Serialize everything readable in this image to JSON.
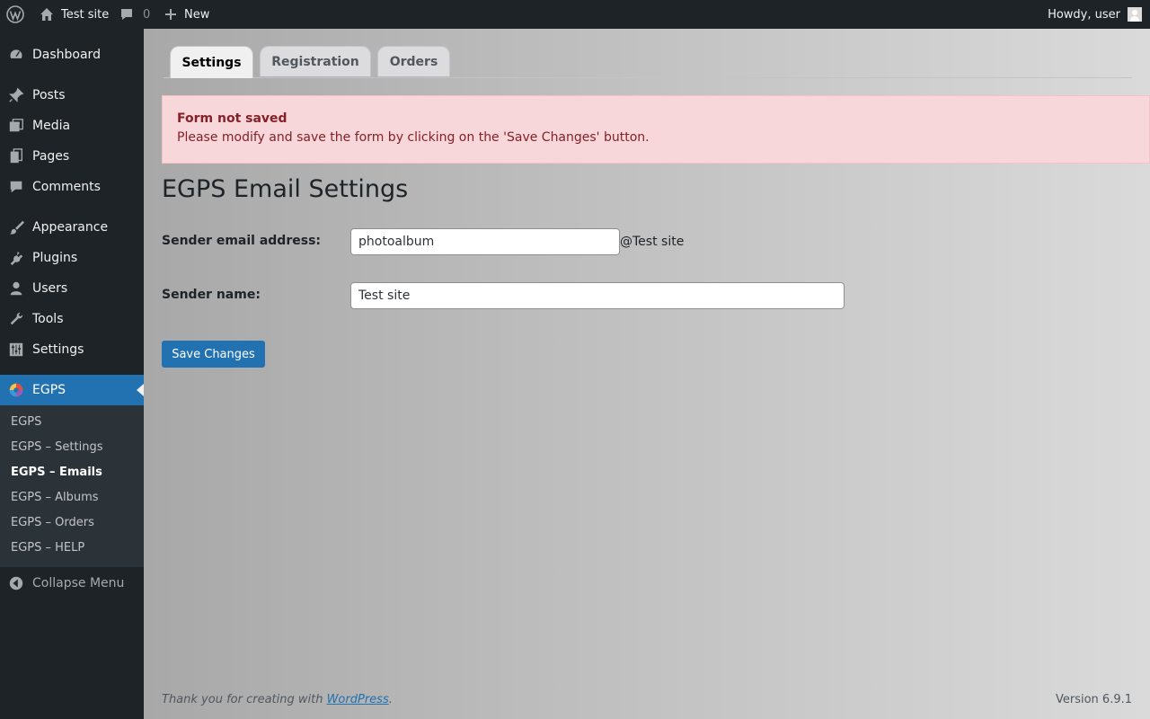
{
  "adminbar": {
    "wp_logo_icon": "wordpress-logo-icon",
    "site_name": "Test site",
    "comments_count": "0",
    "new_label": "New",
    "howdy": "Howdy, user"
  },
  "sidebar": {
    "items": [
      {
        "label": "Dashboard",
        "icon": "dashboard-icon"
      },
      {
        "label": "Posts",
        "icon": "pin-icon"
      },
      {
        "label": "Media",
        "icon": "media-icon"
      },
      {
        "label": "Pages",
        "icon": "pages-icon"
      },
      {
        "label": "Comments",
        "icon": "comment-icon"
      },
      {
        "label": "Appearance",
        "icon": "brush-icon"
      },
      {
        "label": "Plugins",
        "icon": "plug-icon"
      },
      {
        "label": "Users",
        "icon": "user-icon"
      },
      {
        "label": "Tools",
        "icon": "wrench-icon"
      },
      {
        "label": "Settings",
        "icon": "sliders-icon"
      },
      {
        "label": "EGPS",
        "icon": "egps-logo-icon"
      }
    ],
    "submenu": [
      "EGPS",
      "EGPS – Settings",
      "EGPS – Emails",
      "EGPS – Albums",
      "EGPS – Orders",
      "EGPS – HELP"
    ],
    "current_submenu": "EGPS – Emails",
    "collapse_label": "Collapse Menu",
    "active_color": "#2271b1"
  },
  "tabs": [
    "Settings",
    "Registration",
    "Orders"
  ],
  "notice": {
    "title": "Form not saved",
    "text": "Please modify and save the form by clicking on the 'Save Changes' button."
  },
  "page_title": "EGPS Email Settings",
  "form": {
    "sender_email_label": "Sender email address:",
    "sender_email_value": "photoalbum",
    "sender_email_suffix": "@Test site",
    "sender_name_label": "Sender name:",
    "sender_name_value": "Test site",
    "save_label": "Save Changes"
  },
  "footer": {
    "thanks_prefix": "Thank you for creating with ",
    "thanks_link": "WordPress",
    "thanks_suffix": ".",
    "version": "Version 6.9.1"
  }
}
